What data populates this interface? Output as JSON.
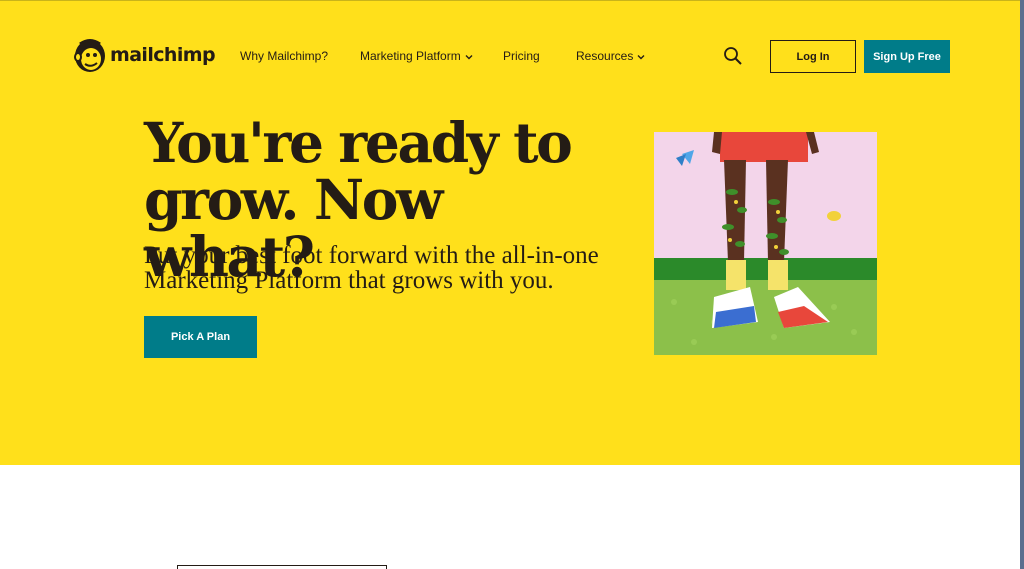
{
  "header": {
    "brand": "mailchimp",
    "nav": [
      {
        "label": "Why Mailchimp?",
        "has_dropdown": false
      },
      {
        "label": "Marketing Platform",
        "has_dropdown": true
      },
      {
        "label": "Pricing",
        "has_dropdown": false
      },
      {
        "label": "Resources",
        "has_dropdown": true
      }
    ],
    "search_icon": "search-icon",
    "login_label": "Log In",
    "signup_label": "Sign Up Free"
  },
  "hero": {
    "headline": "You're ready to grow. Now what?",
    "subheadline": "Put your best foot forward with the all-in-one Marketing Platform that grows with you.",
    "cta_label": "Pick A Plan",
    "image": "legs-with-sneakers-and-plants"
  },
  "colors": {
    "hero_background": "#ffe01b",
    "brand_teal": "#007c89",
    "text_dark": "#241c15"
  }
}
